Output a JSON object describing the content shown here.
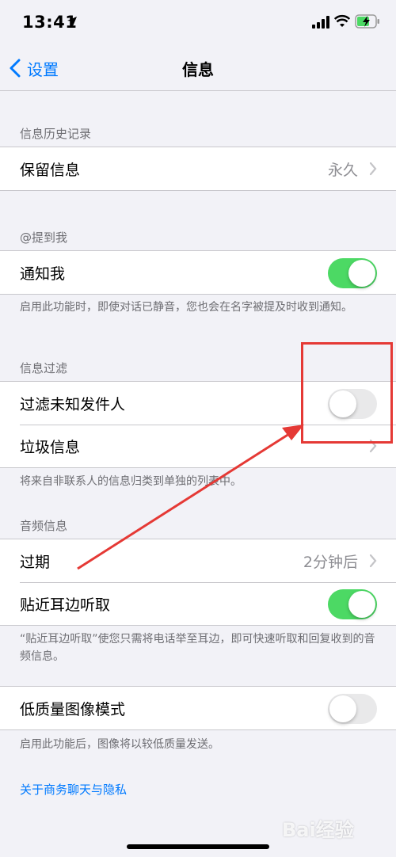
{
  "status_bar": {
    "time": "13:41"
  },
  "nav": {
    "back_label": "设置",
    "title": "信息"
  },
  "sections": {
    "history": {
      "header": "信息历史记录",
      "rows": [
        {
          "label": "保留信息",
          "value": "永久"
        }
      ]
    },
    "mentions": {
      "header": "@提到我",
      "rows": [
        {
          "label": "通知我",
          "toggle": true
        }
      ],
      "footer": "启用此功能时，即使对话已静音，您也会在名字被提及时收到通知。"
    },
    "filter": {
      "header": "信息过滤",
      "rows": [
        {
          "label": "过滤未知发件人",
          "toggle": false
        },
        {
          "label": "垃圾信息"
        }
      ],
      "footer": "将来自非联系人的信息归类到单独的列表中。"
    },
    "audio": {
      "header": "音频信息",
      "rows": [
        {
          "label": "过期",
          "value": "2分钟后"
        },
        {
          "label": "贴近耳边听取",
          "toggle": true
        }
      ],
      "footer": "“贴近耳边听取”使您只需将电话举至耳边，即可快速听取和回复收到的音频信息。"
    },
    "image": {
      "rows": [
        {
          "label": "低质量图像模式",
          "toggle": false
        }
      ],
      "footer": "启用此功能后，图像将以较低质量发送。"
    }
  },
  "link": {
    "label": "关于商务聊天与隐私"
  },
  "watermark": "Bai经验",
  "colors": {
    "accent": "#007aff",
    "toggle_on": "#4cd964",
    "annotation": "#e53935"
  }
}
